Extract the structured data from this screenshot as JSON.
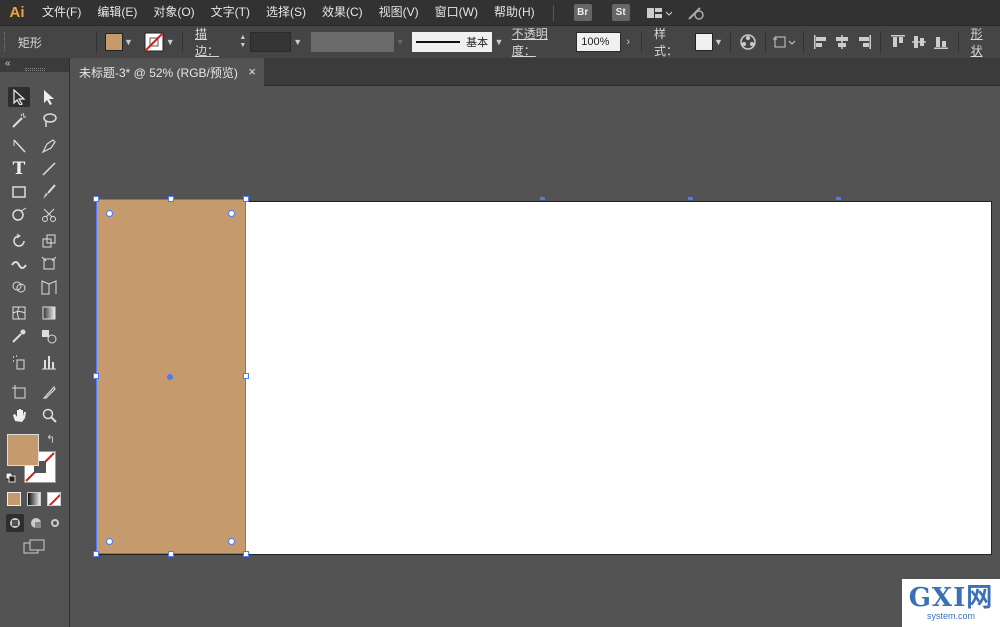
{
  "app": {
    "logo": "Ai"
  },
  "menu": [
    "文件(F)",
    "编辑(E)",
    "对象(O)",
    "文字(T)",
    "选择(S)",
    "效果(C)",
    "视图(V)",
    "窗口(W)",
    "帮助(H)"
  ],
  "menu_badges": [
    "Br",
    "St"
  ],
  "control": {
    "object_type": "矩形",
    "fill_color": "#c59a6d",
    "stroke_label": "描边：",
    "stroke_value": "",
    "brush_label": "基本",
    "opacity_label": "不透明度：",
    "opacity_value": "100%",
    "style_label": "样式：",
    "shape_label": "形状"
  },
  "document": {
    "tab_title": "未标题-3* @ 52% (RGB/预览)",
    "close": "×"
  },
  "selection": {
    "fill": "#c59a6d",
    "handle_color": "#4b79ff"
  },
  "watermark": {
    "big": "GXI网",
    "small": "system.com"
  }
}
